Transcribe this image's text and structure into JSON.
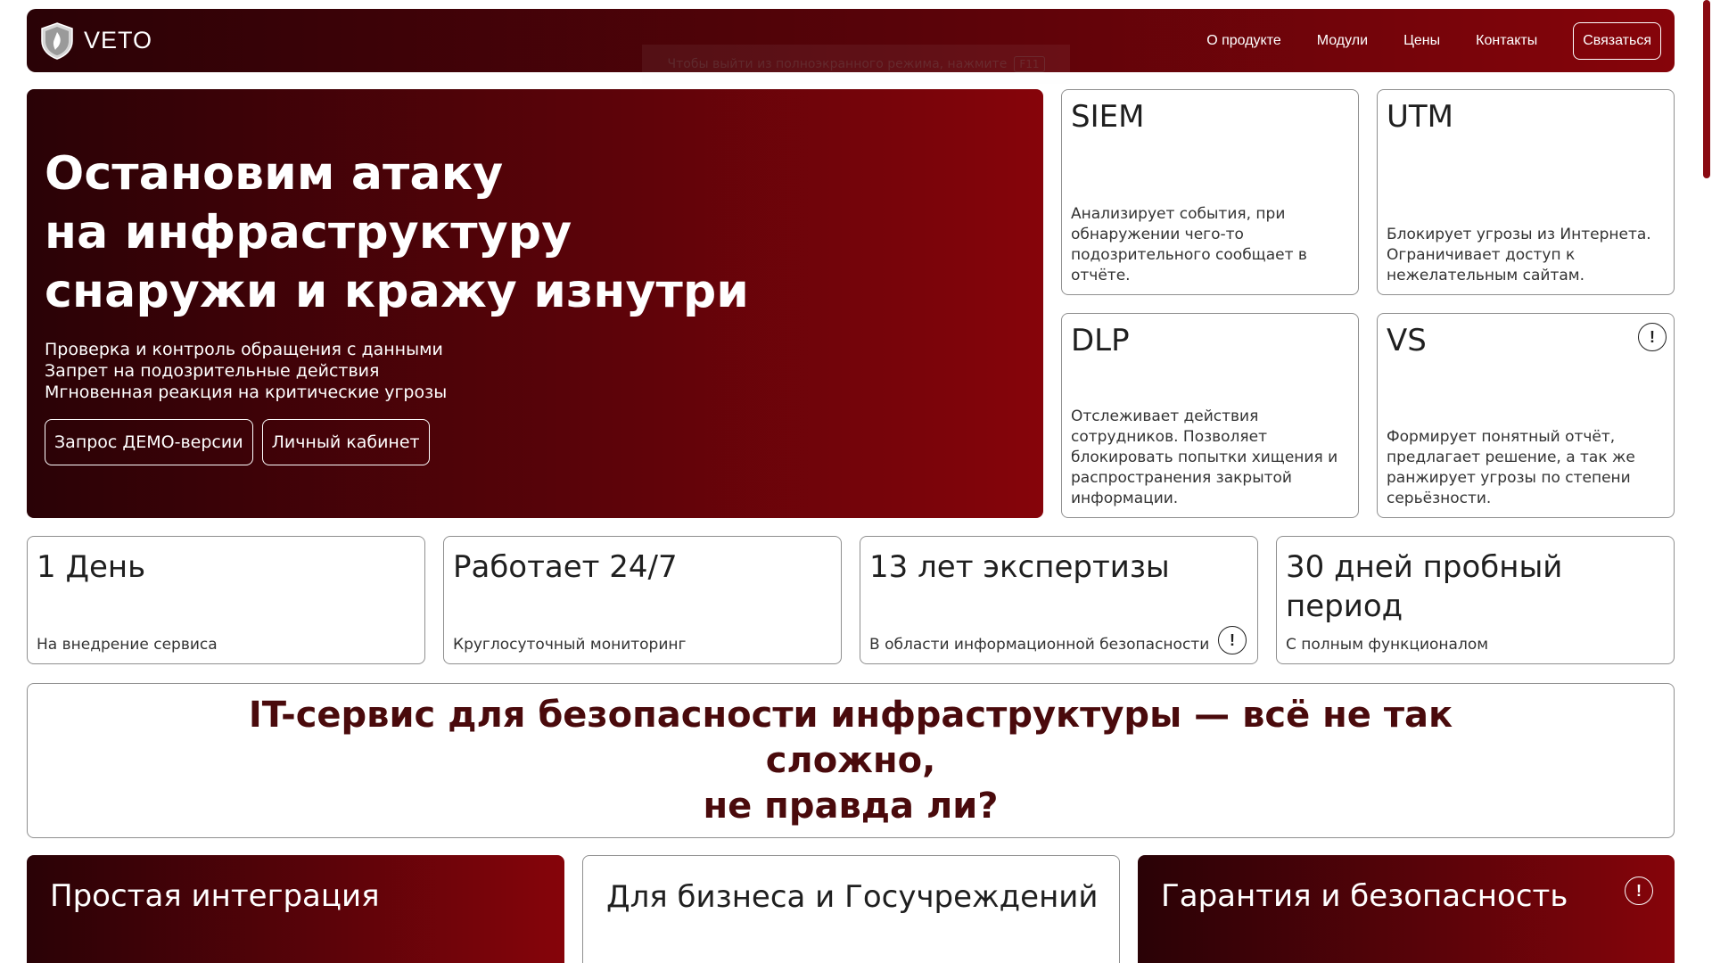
{
  "header": {
    "logo_text": "VETO",
    "logo_icon": "shield-logo-icon",
    "nav": [
      "О продукте",
      "Модули",
      "Цены",
      "Контакты"
    ],
    "cta": "Связаться"
  },
  "fullscreen_hint": {
    "text": "Чтобы выйти из полноэкранного режима, нажмите",
    "key": "F11"
  },
  "hero": {
    "title_lines": [
      "Остановим атаку",
      "на инфраструктуру",
      "снаружи и кражу изнутри"
    ],
    "lines": [
      "Проверка и контроль обращения с данными",
      "Запрет на подозрительные действия",
      "Мгновенная реакция на критические угрозы"
    ],
    "buttons": [
      "Запрос ДЕМО-версии",
      "Личный кабинет"
    ]
  },
  "modules": [
    {
      "title": "SIEM",
      "desc": "Анализирует события, при обнаружении чего-то подозрительного сообщает в отчёте."
    },
    {
      "title": "UTM",
      "desc": "Блокирует угрозы из Интернета. Ограничивает доступ к нежелательным сайтам."
    },
    {
      "title": "DLP",
      "desc": "Отслеживает действия сотрудников. Позволяет блокировать попытки хищения и распространения закрытой информации."
    },
    {
      "title": "VS",
      "desc": "Формирует понятный отчёт, предлагает решение, а так же ранжирует угрозы по степени серьёзности."
    }
  ],
  "stats": [
    {
      "title": "1 День",
      "sub": "На внедрение сервиса"
    },
    {
      "title": "Работает 24/7",
      "sub": "Круглосуточный мониторинг"
    },
    {
      "title": "13 лет экспертизы",
      "sub": "В области информационной безопасности"
    },
    {
      "title": "30 дней пробный период",
      "sub": "С полным функционалом"
    }
  ],
  "banner": {
    "line1": "IT-сервис для безопасности инфраструктуры — всё не так сложно,",
    "line2": "не правда ли?"
  },
  "bottom_cards": [
    {
      "title": "Простая интеграция",
      "sub": ""
    },
    {
      "title": "Для бизнеса и Госучреждений",
      "sub": ""
    },
    {
      "title": "Гарантия и безопасность",
      "sub": ""
    }
  ],
  "info_glyph": "!",
  "colors": {
    "brand_dark": "#2a0206",
    "brand_red": "#86040a",
    "banner_text": "#4a0a0c"
  }
}
